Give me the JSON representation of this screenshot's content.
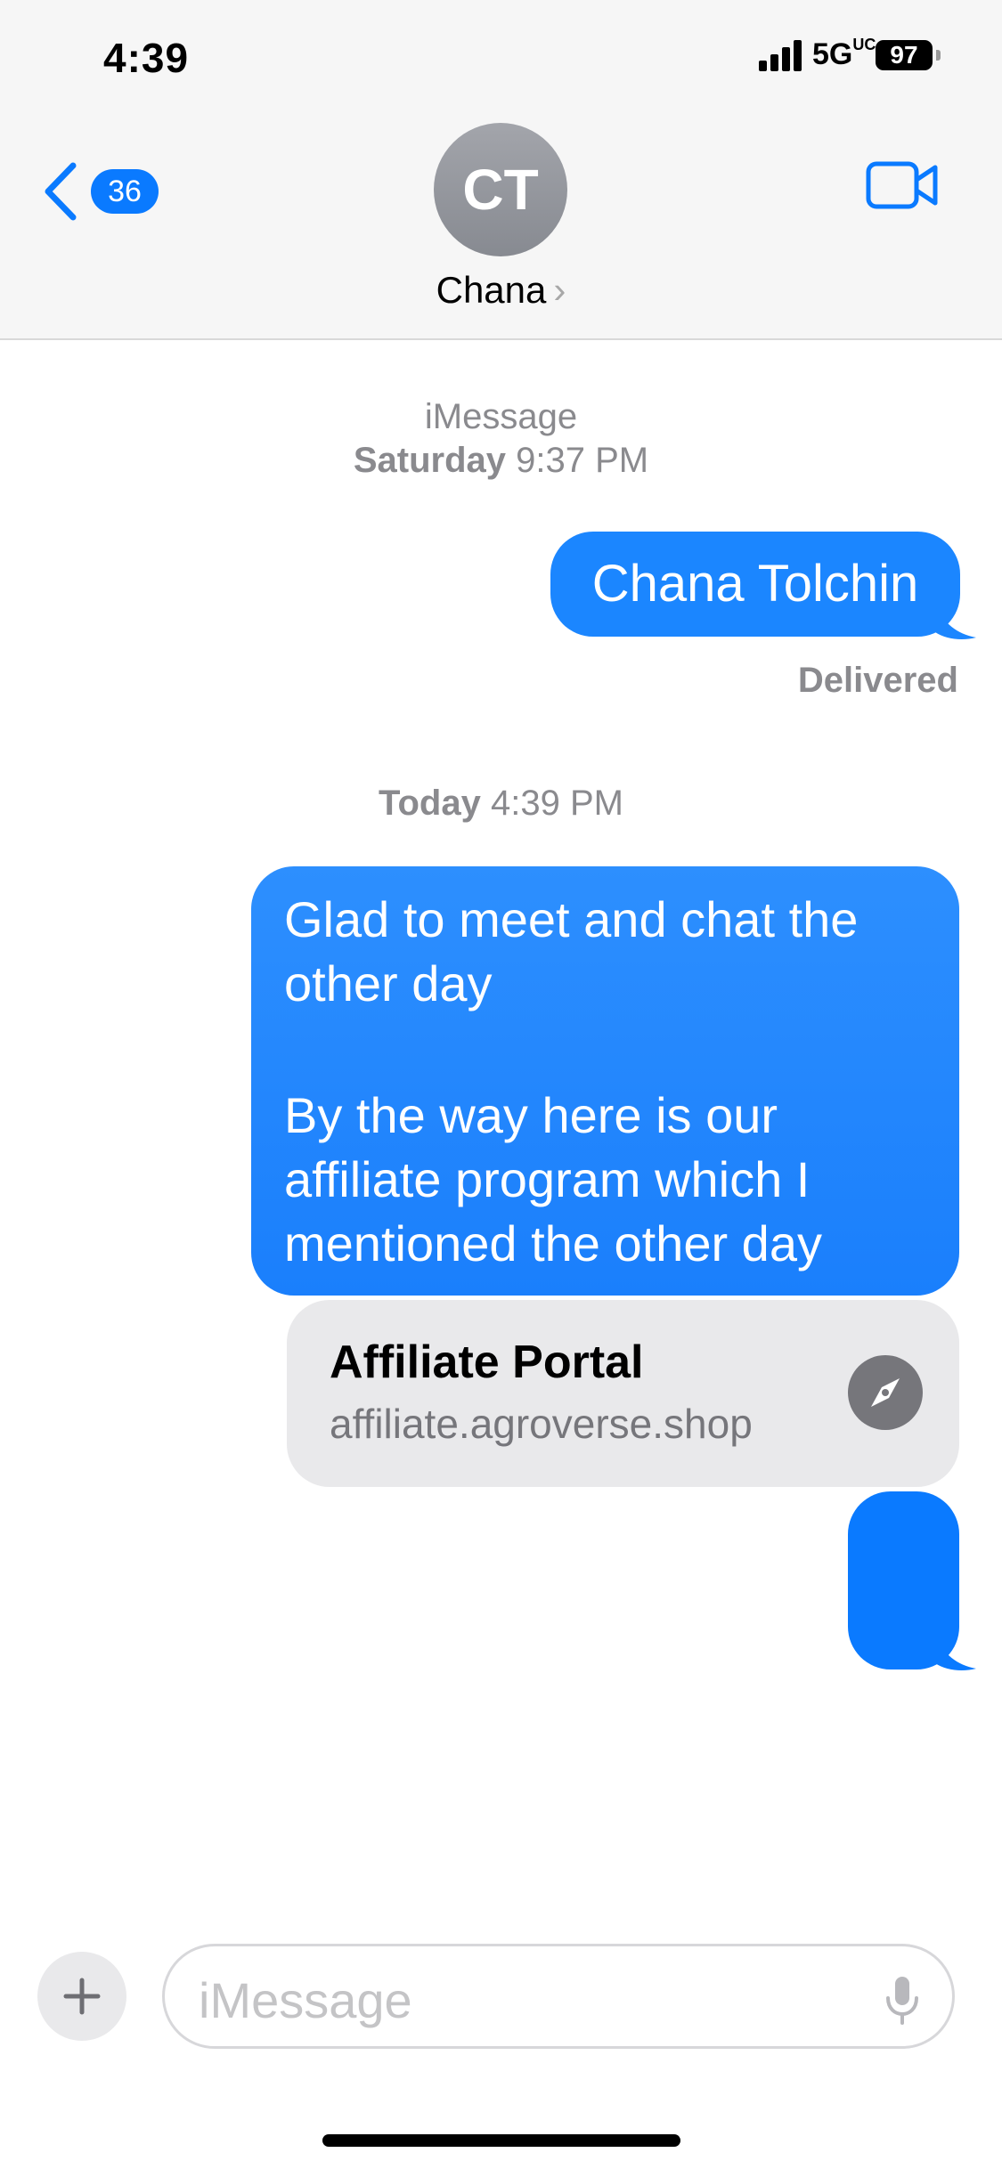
{
  "status_bar": {
    "time": "4:39",
    "network": "5G",
    "network_suffix": "UC",
    "battery": "97"
  },
  "header": {
    "unread_count": "36",
    "avatar_initials": "CT",
    "contact_name": "Chana",
    "chevron": "›"
  },
  "thread": {
    "meta1": {
      "service": "iMessage",
      "day": "Saturday",
      "time": "9:37 PM"
    },
    "msg1": "Chana Tolchin",
    "msg1_status": "Delivered",
    "meta2": {
      "day": "Today",
      "time": "4:39 PM"
    },
    "msg2_line1": "Glad to meet and chat the other day",
    "msg2_line2": "By the way here is our affiliate program which I mentioned the other day",
    "link_preview": {
      "title": "Affiliate Portal",
      "domain": "affiliate.agroverse.shop"
    }
  },
  "compose": {
    "placeholder": "iMessage"
  },
  "colors": {
    "bubble_blue": "#1b86ff",
    "accent": "#0a7aff",
    "meta_gray": "#8a8a8e"
  },
  "icons": [
    "back-chevron-icon",
    "video-camera-icon",
    "compass-icon",
    "plus-icon",
    "microphone-icon",
    "signal-icon",
    "battery-icon"
  ]
}
